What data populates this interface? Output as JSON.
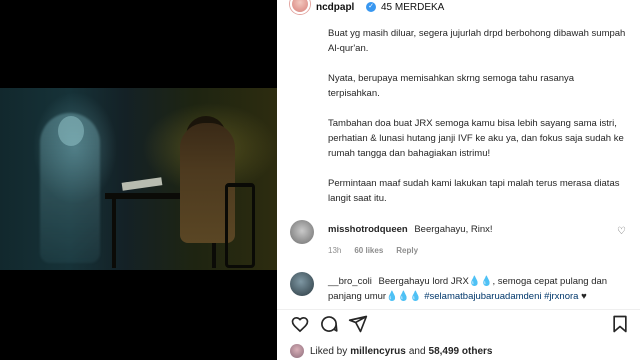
{
  "post": {
    "username": "ncdpapl",
    "location": "45 MERDEKA",
    "caption": [
      "Buat yg masih diluar, segera jujurlah drpd berbohong dibawah sumpah Al-qur'an.",
      "Nyata, berupaya memisahkan skrng semoga tahu rasanya terpisahkan.",
      "Tambahan doa buat JRX semoga kamu bisa lebih sayang sama istri, perhatian & lunasi hutang janji IVF ke aku ya, dan fokus saja sudah ke rumah tangga dan bahagiakan istrimu!",
      "Permintaan maaf sudah kami lakukan tapi malah terus merasa diatas langit saat itu."
    ]
  },
  "comments": [
    {
      "user": "misshotrodqueen",
      "text": "Beergahayu, Rinx!",
      "time": "13h",
      "likes": "60 likes",
      "reply": "Reply"
    },
    {
      "user": "__bro_coli",
      "text": "Beergahayu lord JRX💧💧, semoga cepat pulang dan panjang umur💧💧💧",
      "hashtags": "#selamatbajubaruadamdeni #jrxnora",
      "tail": " ♥"
    }
  ],
  "likes": {
    "prefix": "Liked by",
    "user": "millencyrus",
    "and": "and",
    "count": "58,499 others"
  },
  "icons": {
    "verified": "verified-badge-icon",
    "like": "heart-icon",
    "comment": "comment-icon",
    "share": "send-icon",
    "save": "bookmark-icon"
  }
}
